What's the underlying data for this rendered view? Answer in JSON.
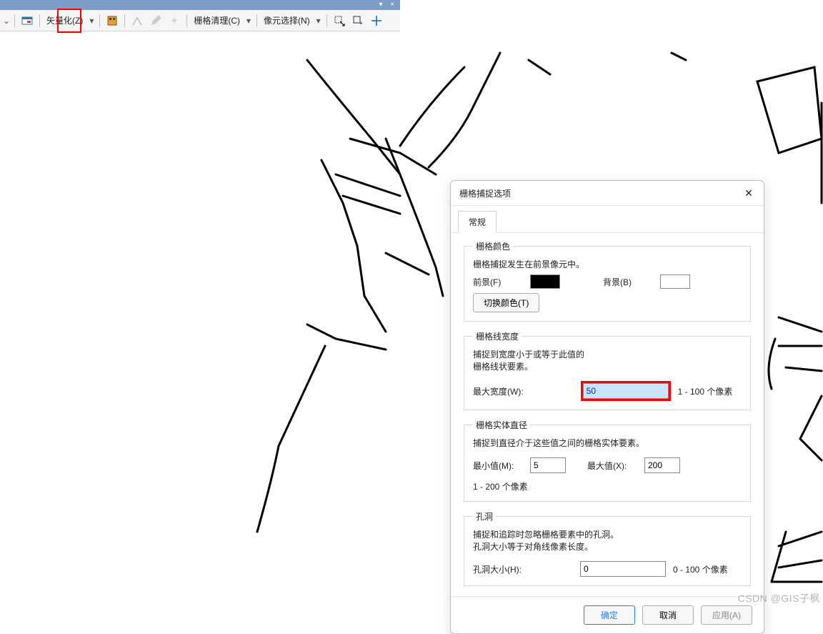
{
  "toolbar": {
    "vectorize_label": "矢量化(Z)",
    "grid_clean_label": "栅格清理(C)",
    "pixel_select_label": "像元选择(N)"
  },
  "dialog": {
    "title": "栅格捕捉选项",
    "tab_general": "常规",
    "color_group": "栅格颜色",
    "color_note": "栅格捕捉发生在前景像元中。",
    "fg_label": "前景(F)",
    "bg_label": "背景(B)",
    "swap_btn": "切换颜色(T)",
    "linewidth_group": "栅格线宽度",
    "linewidth_note1": "捕捉到宽度小于或等于此值的",
    "linewidth_note2": "栅格线状要素。",
    "maxwidth_label": "最大宽度(W):",
    "maxwidth_value": "50",
    "maxwidth_range": "1 - 100 个像素",
    "solid_group": "栅格实体直径",
    "solid_note": "捕捉到直径介于这些值之间的栅格实体要素。",
    "min_label": "最小值(M):",
    "min_value": "5",
    "max_label": "最大值(X):",
    "max_value": "200",
    "solid_range": "1 - 200 个像素",
    "hole_group": "孔洞",
    "hole_note1": "捕捉和追踪时忽略栅格要素中的孔洞。",
    "hole_note2": "孔洞大小等于对角线像素长度。",
    "hole_label": "孔洞大小(H):",
    "hole_value": "0",
    "hole_range": "0 - 100 个像素",
    "ok_btn": "确定",
    "cancel_btn": "取消",
    "apply_btn": "应用(A)"
  },
  "watermark": "CSDN @GIS子枫"
}
